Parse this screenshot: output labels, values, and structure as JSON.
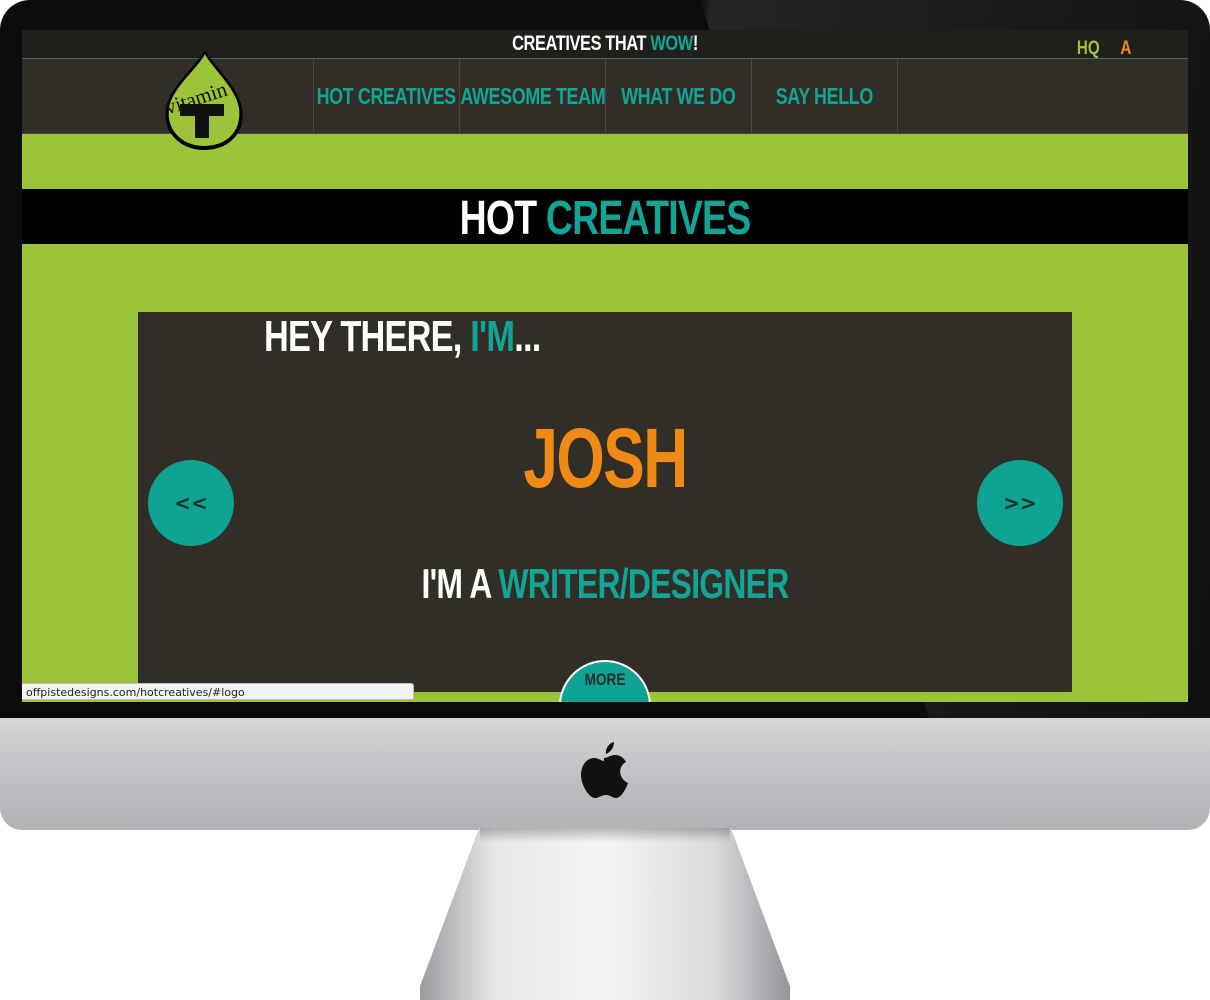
{
  "header": {
    "tagline_prefix": "CREATIVES THAT ",
    "tagline_highlight": "WOW",
    "tagline_suffix": "!",
    "hq_link": "HQ",
    "a_link": "A"
  },
  "logo": {
    "icon": "vitamin-t-drop-logo",
    "brand_text": "vitamin",
    "brand_letter": "T"
  },
  "nav": {
    "items": [
      {
        "label": "HOT CREATIVES"
      },
      {
        "label": "AWESOME TEAM"
      },
      {
        "label": "WHAT WE DO"
      },
      {
        "label": "SAY HELLO"
      }
    ]
  },
  "section": {
    "title_part1": "HOT ",
    "title_part2": "CREATIVES"
  },
  "profile": {
    "greeting_prefix": "HEY THERE, ",
    "greeting_highlight": "I'M",
    "greeting_suffix": "...",
    "name": "JOSH",
    "role_prefix": "I'M A ",
    "role_highlight": "WRITER/DESIGNER",
    "prev_label": "<<",
    "next_label": ">>",
    "more_label": "MORE"
  },
  "status_bar": {
    "url": "offpistedesigns.com/hotcreatives/#logo"
  },
  "colors": {
    "green": "#9bc43a",
    "teal": "#12a596",
    "orange": "#ef8a17",
    "dark": "#312d27"
  },
  "device": {
    "brand_icon": "apple-logo-icon"
  }
}
